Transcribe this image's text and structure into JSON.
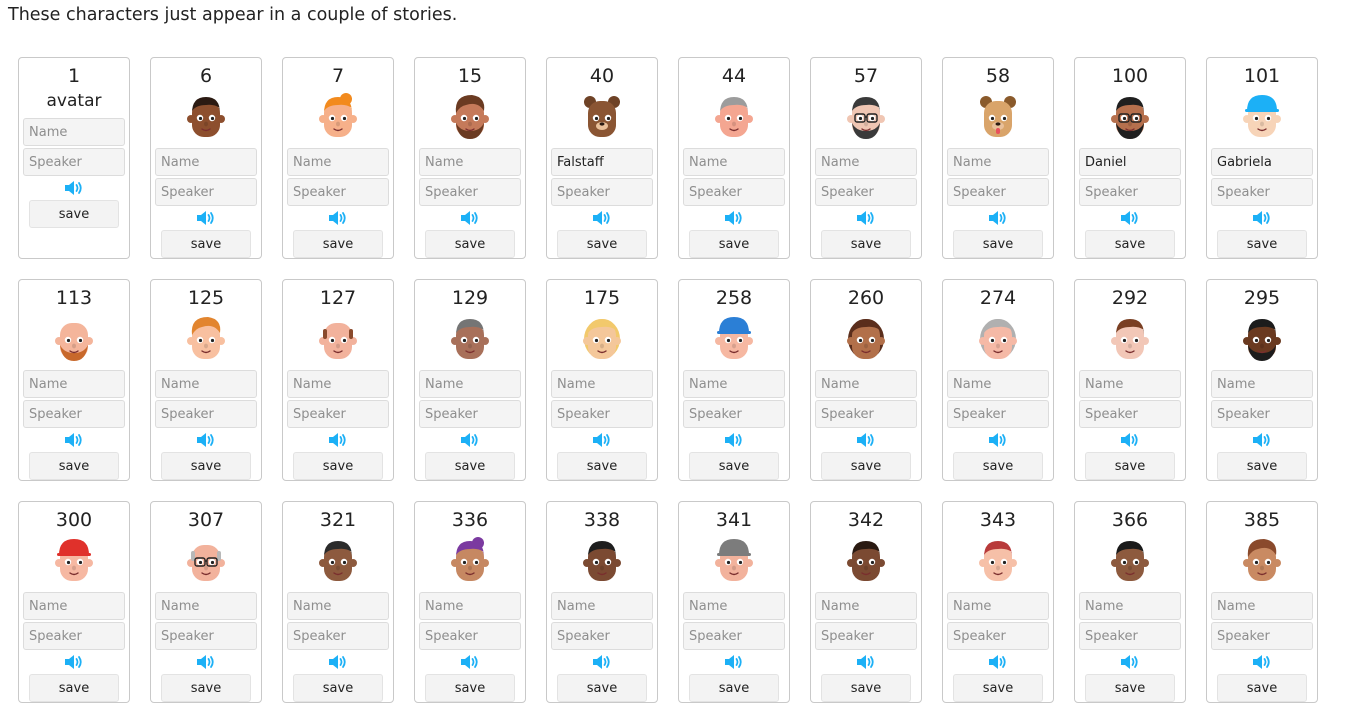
{
  "intro_text": "These characters just appear in a couple of stories.",
  "placeholders": {
    "name": "Name",
    "speaker": "Speaker"
  },
  "save_label": "save",
  "cards": [
    {
      "id": "1",
      "caption": "avatar",
      "avatar": "none",
      "name": "",
      "speaker": ""
    },
    {
      "id": "6",
      "avatar": "dark-skin-man",
      "name": "",
      "speaker": ""
    },
    {
      "id": "7",
      "avatar": "orange-hair-girl",
      "name": "",
      "speaker": ""
    },
    {
      "id": "15",
      "avatar": "brown-hair-man",
      "name": "",
      "speaker": ""
    },
    {
      "id": "40",
      "avatar": "bear",
      "name": "Falstaff",
      "speaker": ""
    },
    {
      "id": "44",
      "avatar": "grey-hair-man",
      "name": "",
      "speaker": ""
    },
    {
      "id": "57",
      "avatar": "bearded-man-glasses",
      "name": "",
      "speaker": ""
    },
    {
      "id": "58",
      "avatar": "dog",
      "name": "",
      "speaker": ""
    },
    {
      "id": "100",
      "avatar": "man-glasses",
      "name": "Daniel",
      "speaker": ""
    },
    {
      "id": "101",
      "avatar": "girl-blue-cap",
      "name": "Gabriela",
      "speaker": ""
    },
    {
      "id": "113",
      "avatar": "bald-bearded-man",
      "name": "",
      "speaker": ""
    },
    {
      "id": "125",
      "avatar": "ginger-boy",
      "name": "",
      "speaker": ""
    },
    {
      "id": "127",
      "avatar": "balding-man",
      "name": "",
      "speaker": ""
    },
    {
      "id": "129",
      "avatar": "grey-hair-woman",
      "name": "",
      "speaker": ""
    },
    {
      "id": "175",
      "avatar": "blonde-woman",
      "name": "",
      "speaker": ""
    },
    {
      "id": "258",
      "avatar": "blue-cap-man",
      "name": "",
      "speaker": ""
    },
    {
      "id": "260",
      "avatar": "curly-hair-girl",
      "name": "",
      "speaker": ""
    },
    {
      "id": "274",
      "avatar": "old-woman",
      "name": "",
      "speaker": ""
    },
    {
      "id": "292",
      "avatar": "brown-hair-person",
      "name": "",
      "speaker": ""
    },
    {
      "id": "295",
      "avatar": "dark-skin-man-2",
      "name": "",
      "speaker": ""
    },
    {
      "id": "300",
      "avatar": "red-helmet",
      "name": "",
      "speaker": ""
    },
    {
      "id": "307",
      "avatar": "old-man-glasses",
      "name": "",
      "speaker": ""
    },
    {
      "id": "321",
      "avatar": "man-sunglasses",
      "name": "",
      "speaker": ""
    },
    {
      "id": "336",
      "avatar": "purple-hair-woman",
      "name": "",
      "speaker": ""
    },
    {
      "id": "338",
      "avatar": "dark-hair-woman",
      "name": "",
      "speaker": ""
    },
    {
      "id": "341",
      "avatar": "grey-beanie",
      "name": "",
      "speaker": ""
    },
    {
      "id": "342",
      "avatar": "woman-flower",
      "name": "",
      "speaker": ""
    },
    {
      "id": "343",
      "avatar": "red-hair-woman",
      "name": "",
      "speaker": ""
    },
    {
      "id": "366",
      "avatar": "dark-skin-boy",
      "name": "",
      "speaker": ""
    },
    {
      "id": "385",
      "avatar": "brown-hair-man-2",
      "name": "",
      "speaker": ""
    }
  ],
  "colors": {
    "speaker_icon": "#1cb0f6",
    "card_border": "#c9c9c9",
    "field_bg": "#f4f4f4",
    "button_bg": "#f3f3f3"
  }
}
